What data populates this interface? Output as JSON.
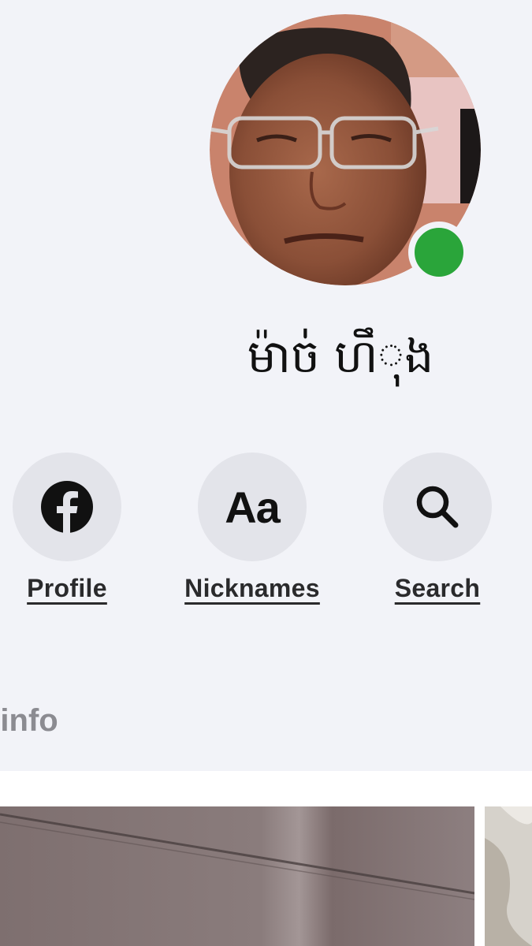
{
  "contact": {
    "name": "ម៉ាច់ ហឹុង",
    "online": true,
    "status_color": "#2aa53a",
    "avatar_description_icon": "person-avatar"
  },
  "actions": [
    {
      "label": "Profile",
      "icon": "facebook-icon"
    },
    {
      "label": "Nicknames",
      "icon": "text-aa-icon"
    },
    {
      "label": "Search",
      "icon": "search-icon"
    }
  ],
  "aa_glyph": "Aa",
  "sections": {
    "info_label": "t info"
  },
  "colors": {
    "background": "#f2f3f8",
    "button_bg": "#e3e4ea",
    "online": "#2aa53a",
    "label": "#2a2a2c",
    "section_label": "#8b8b91"
  }
}
